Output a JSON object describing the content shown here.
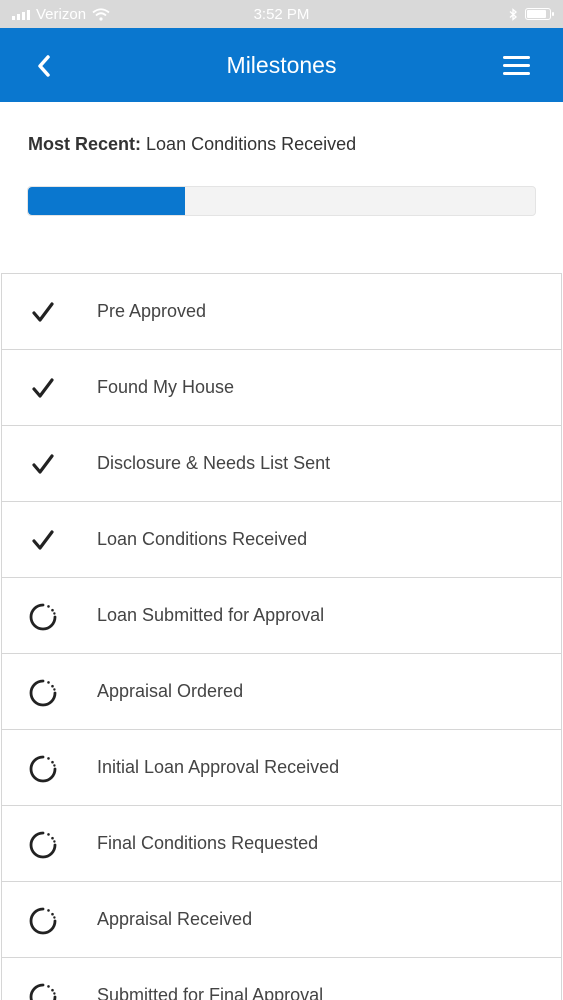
{
  "status_bar": {
    "carrier": "Verizon",
    "time": "3:52 PM"
  },
  "nav": {
    "title": "Milestones"
  },
  "summary": {
    "prefix": "Most Recent:",
    "value": "Loan Conditions Received"
  },
  "progress": {
    "fraction": 0.31
  },
  "milestones": [
    {
      "label": "Pre Approved",
      "status": "complete"
    },
    {
      "label": "Found My House",
      "status": "complete"
    },
    {
      "label": "Disclosure & Needs List Sent",
      "status": "complete"
    },
    {
      "label": "Loan Conditions Received",
      "status": "complete"
    },
    {
      "label": "Loan Submitted for Approval",
      "status": "pending"
    },
    {
      "label": "Appraisal Ordered",
      "status": "pending"
    },
    {
      "label": "Initial Loan Approval Received",
      "status": "pending"
    },
    {
      "label": "Final Conditions Requested",
      "status": "pending"
    },
    {
      "label": "Appraisal Received",
      "status": "pending"
    },
    {
      "label": "Submitted for Final Approval",
      "status": "pending"
    }
  ],
  "colors": {
    "brand": "#0a77cf",
    "divider": "#d6d6d6"
  }
}
